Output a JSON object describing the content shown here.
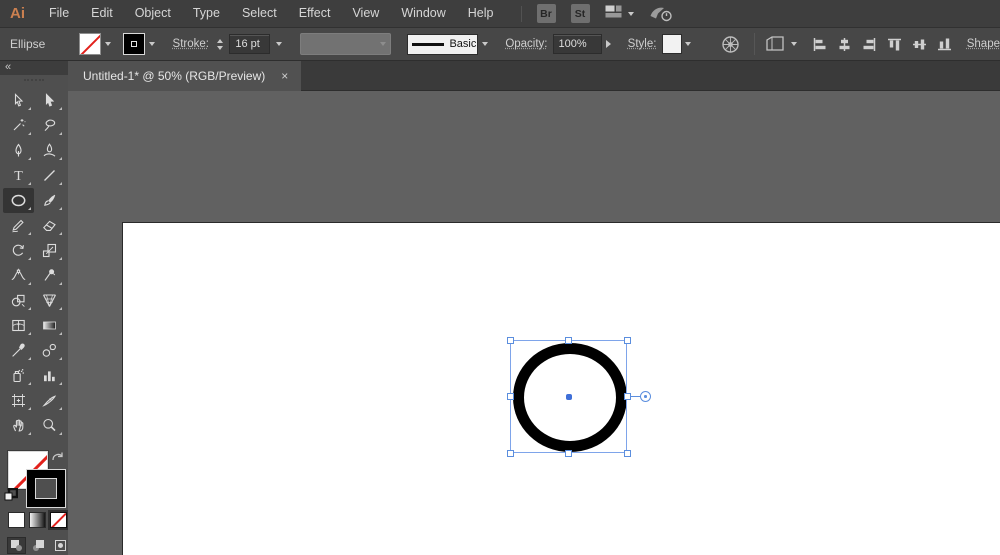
{
  "menu_bar": {
    "logo": "Ai",
    "items": [
      "File",
      "Edit",
      "Object",
      "Type",
      "Select",
      "Effect",
      "View",
      "Window",
      "Help"
    ],
    "bridge_label": "Br",
    "stock_label": "St"
  },
  "control_bar": {
    "context_label": "Ellipse",
    "fill_swatch": "None",
    "stroke_swatch": "Black",
    "stroke_label": "Stroke:",
    "stroke_weight": "16 pt",
    "stroke_style_label": "Basic",
    "opacity_label": "Opacity:",
    "opacity_value": "100%",
    "style_label": "Style:",
    "shape_link_label": "Shape"
  },
  "tab_bar": {
    "tabs": [
      {
        "title": "Untitled-1* @ 50% (RGB/Preview)",
        "close_glyph": "×",
        "active": true
      }
    ]
  },
  "toolbar": {
    "collapse_glyph": "«",
    "tools": [
      {
        "id": "selection",
        "label": "Selection Tool"
      },
      {
        "id": "direct-selection",
        "label": "Direct Selection Tool"
      },
      {
        "id": "magic-wand",
        "label": "Magic Wand Tool"
      },
      {
        "id": "lasso",
        "label": "Lasso Tool"
      },
      {
        "id": "pen",
        "label": "Pen Tool"
      },
      {
        "id": "curvature",
        "label": "Curvature Tool"
      },
      {
        "id": "type",
        "label": "Type Tool"
      },
      {
        "id": "line-segment",
        "label": "Line Segment Tool"
      },
      {
        "id": "ellipse",
        "label": "Ellipse Tool",
        "selected": true
      },
      {
        "id": "paintbrush",
        "label": "Paintbrush Tool"
      },
      {
        "id": "shaper",
        "label": "Shaper Tool"
      },
      {
        "id": "eraser",
        "label": "Eraser Tool"
      },
      {
        "id": "rotate",
        "label": "Rotate Tool"
      },
      {
        "id": "scale",
        "label": "Scale Tool"
      },
      {
        "id": "width",
        "label": "Width Tool"
      },
      {
        "id": "puppet-warp",
        "label": "Puppet Warp Tool"
      },
      {
        "id": "shape-builder",
        "label": "Shape Builder Tool"
      },
      {
        "id": "perspective-grid",
        "label": "Perspective Grid Tool"
      },
      {
        "id": "mesh",
        "label": "Mesh Tool"
      },
      {
        "id": "gradient",
        "label": "Gradient Tool"
      },
      {
        "id": "eyedropper",
        "label": "Eyedropper Tool"
      },
      {
        "id": "blend",
        "label": "Blend Tool"
      },
      {
        "id": "symbol-sprayer",
        "label": "Symbol Sprayer Tool"
      },
      {
        "id": "column-graph",
        "label": "Column Graph Tool"
      },
      {
        "id": "artboard",
        "label": "Artboard Tool"
      },
      {
        "id": "slice",
        "label": "Slice Tool"
      },
      {
        "id": "hand",
        "label": "Hand Tool"
      },
      {
        "id": "zoom",
        "label": "Zoom Tool"
      }
    ],
    "fill_stroke": {
      "fill": "None",
      "stroke": "Black"
    },
    "swatch_buttons": [
      "Color",
      "Gradient",
      "None"
    ],
    "active_swatch": "None",
    "drawing_modes": [
      "Draw Normal",
      "Draw Behind",
      "Draw Inside"
    ],
    "active_drawing_mode": "Draw Normal"
  },
  "canvas": {
    "artboard_color": "#ffffff",
    "shape": {
      "type": "ellipse",
      "fill": "None",
      "stroke_color": "#000000",
      "stroke_weight": "16 pt",
      "selected": true
    }
  },
  "colors": {
    "selection_blue": "#7ea4ea",
    "none_red": "#e2211c",
    "logo_orange": "#cb8050",
    "canvas_gray": "#616161"
  }
}
